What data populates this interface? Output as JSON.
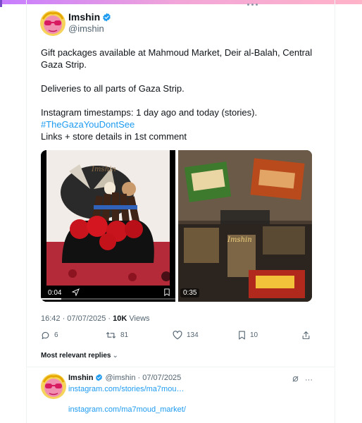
{
  "post": {
    "author_name": "Imshin",
    "author_handle": "@imshin",
    "text_lines": [
      "Gift packages available at Mahmoud Market, Deir al-Balah, Central",
      "Gaza Strip.",
      "",
      "Deliveries to all parts of Gaza Strip.",
      "",
      "Instagram timestamps: 1 day ago and today (stories).",
      "#TheGazaYouDontSee",
      "Links + store details in 1st comment"
    ],
    "media": [
      {
        "type": "video",
        "duration": "0:04",
        "watermark": "Imshin",
        "progress": 0.15
      },
      {
        "type": "video",
        "duration": "0:35",
        "watermark": "Imshin"
      }
    ],
    "timestamp": "16:42 · 07/07/2025 · ",
    "views_count": "10K",
    "views_label": " Views",
    "actions": {
      "replies": "6",
      "reposts": "81",
      "likes": "134",
      "bookmarks": "10"
    }
  },
  "replies_filter": {
    "label": "Most relevant replies",
    "chevron": "⌄"
  },
  "reply": {
    "author_name": "Imshin",
    "author_handle_date": " @imshin · 07/07/2025",
    "link1": "instagram.com/stories/ma7mou…",
    "link2": "instagram.com/ma7moud_market/",
    "more": "···"
  },
  "colors": {
    "accent": "#1d9bf0",
    "verified": "#1d9bf0",
    "secondary_text": "#536471"
  }
}
